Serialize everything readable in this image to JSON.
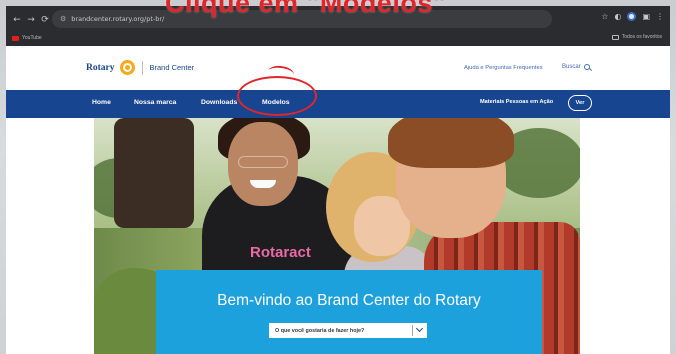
{
  "annotation": {
    "heading": "Clique em \"Modelos\""
  },
  "browser": {
    "url": "brandcenter.rotary.org/pt-br/",
    "bookmark_label": "YouTube",
    "bookmarks_right_label": "Todos os favoritos"
  },
  "site": {
    "logo_text": "Rotary",
    "brand_center": "Brand Center",
    "help_link": "Ajuda e Perguntas Frequentes",
    "search_label": "Buscar"
  },
  "nav": {
    "items": [
      "Home",
      "Nossa marca",
      "Downloads",
      "Modelos"
    ],
    "right_label": "Materiais Pessoas em Ação",
    "ver_button": "Ver"
  },
  "hero": {
    "shirt_text": "Rotaract"
  },
  "welcome": {
    "title": "Bem-vindo ao Brand Center do Rotary",
    "select_placeholder": "O que você gostaria de fazer hoje?"
  },
  "colors": {
    "nav_blue": "#17458f",
    "rotary_gold": "#f7a81b",
    "welcome_cyan": "#1da1dc",
    "annotation_red": "#e0262b"
  }
}
